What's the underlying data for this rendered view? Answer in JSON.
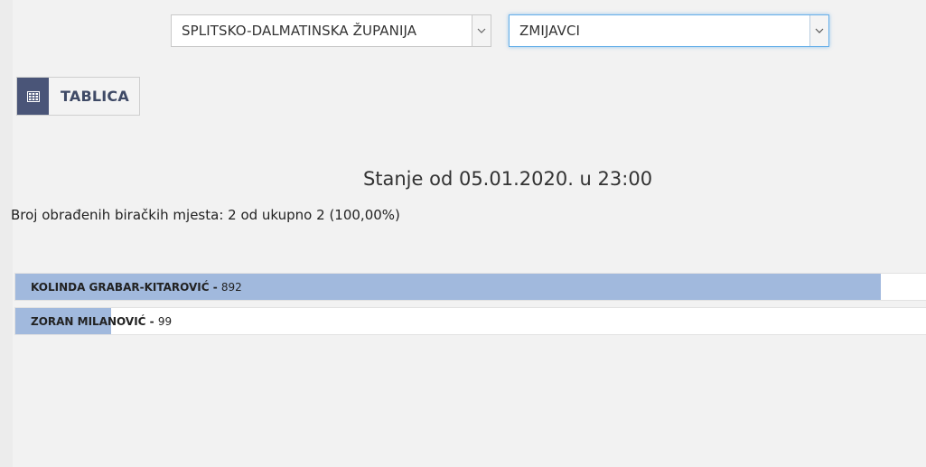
{
  "filters": {
    "county": {
      "selected": "SPLITSKO-DALMATINSKA ŽUPANIJA"
    },
    "municipality": {
      "selected": "ZMIJAVCI"
    }
  },
  "view_toggle": {
    "label": "TABLICA",
    "icon": "table-icon"
  },
  "status": {
    "title": "Stanje od 05.01.2020. u 23:00",
    "polling_stations": "Broj obrađenih biračkih mjesta: 2 od ukupno 2 (100,00%)"
  },
  "results": [
    {
      "name": "KOLINDA GRABAR-KITAROVIĆ",
      "sep": " - ",
      "votes": "892",
      "share": 0.9501
    },
    {
      "name": "ZORAN MILANOVIĆ",
      "sep": " - ",
      "votes": "99",
      "share": 0.1054
    }
  ],
  "colors": {
    "bar_fill": "#a1b9dd",
    "icon_bg": "#4a5578",
    "focus_border": "#66afe9"
  }
}
